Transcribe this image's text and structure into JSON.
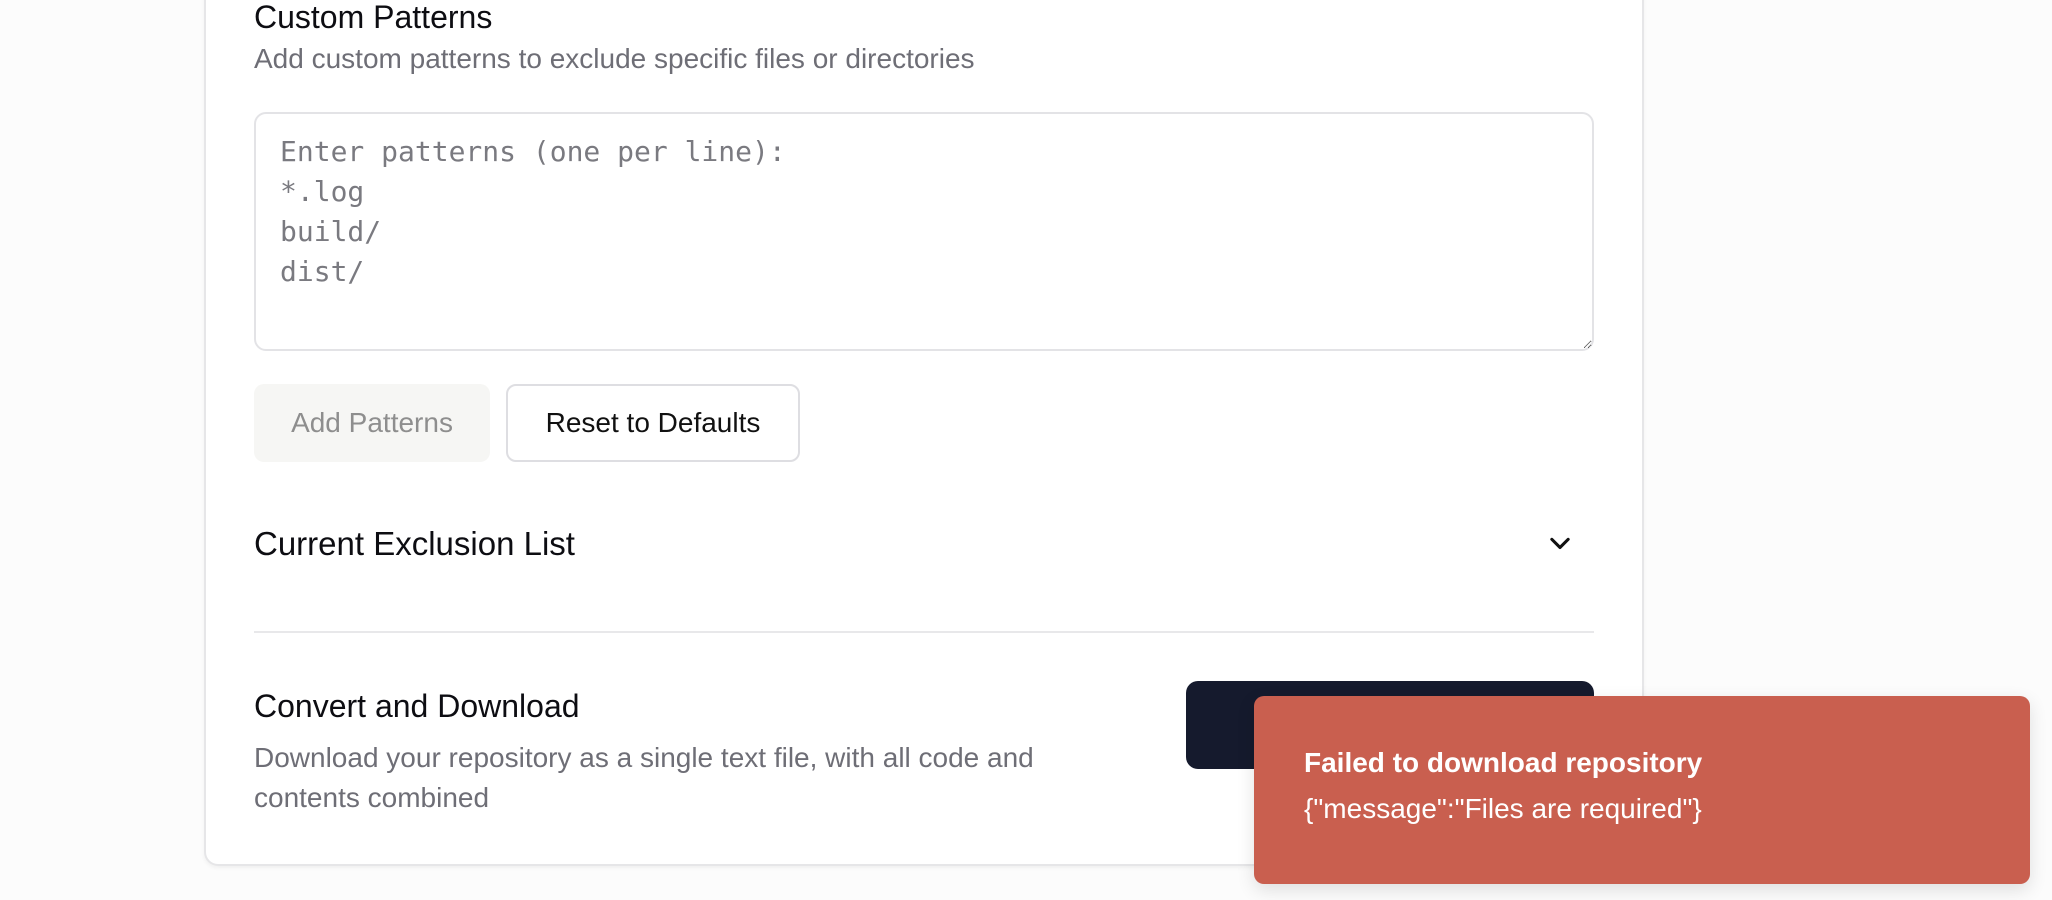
{
  "patterns": {
    "title": "Custom Patterns",
    "description": "Add custom patterns to exclude specific files or directories",
    "placeholder": "Enter patterns (one per line):\n*.log\nbuild/\ndist/",
    "value": "",
    "add_label": "Add Patterns",
    "reset_label": "Reset to Defaults"
  },
  "exclusion": {
    "title": "Current Exclusion List",
    "icon": "chevron-down-icon"
  },
  "convert": {
    "title": "Convert and Download",
    "description": "Download your repository as a single text file, with all code and contents combined",
    "button_label": ""
  },
  "toast": {
    "title": "Failed to download repository",
    "message": "{\"message\":\"Files are required\"}",
    "color": "#c95f4f"
  },
  "colors": {
    "primary_button": "#151a2d",
    "muted_text": "#6e6e76"
  }
}
